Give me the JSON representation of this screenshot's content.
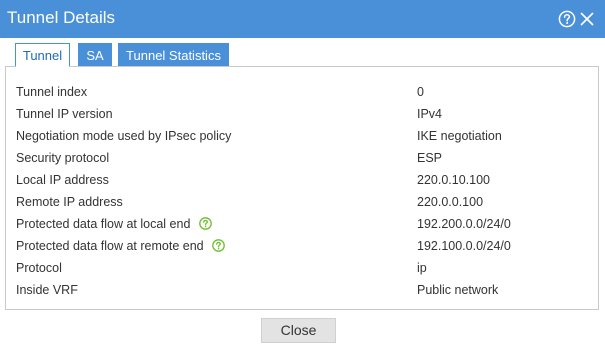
{
  "window": {
    "title": "Tunnel Details",
    "help_icon": "help-circle-icon",
    "close_icon": "close-icon",
    "accent_color": "#4a90d9"
  },
  "tabs": [
    {
      "label": "Tunnel",
      "active": true
    },
    {
      "label": "SA",
      "active": false
    },
    {
      "label": "Tunnel Statistics",
      "active": false
    }
  ],
  "details": [
    {
      "label": "Tunnel index",
      "value": "0",
      "has_help": false
    },
    {
      "label": "Tunnel IP version",
      "value": "IPv4",
      "has_help": false
    },
    {
      "label": "Negotiation mode used by IPsec policy",
      "value": "IKE negotiation",
      "has_help": false
    },
    {
      "label": "Security protocol",
      "value": "ESP",
      "has_help": false
    },
    {
      "label": "Local IP address",
      "value": "220.0.10.100",
      "has_help": false
    },
    {
      "label": "Remote IP address",
      "value": "220.0.0.100",
      "has_help": false
    },
    {
      "label": "Protected data flow at local end",
      "value": "192.200.0.0/24/0",
      "has_help": true
    },
    {
      "label": "Protected data flow at remote end",
      "value": "192.100.0.0/24/0",
      "has_help": true
    },
    {
      "label": "Protocol",
      "value": "ip",
      "has_help": false
    },
    {
      "label": "Inside VRF",
      "value": "Public network",
      "has_help": false
    }
  ],
  "footer": {
    "close_label": "Close"
  }
}
